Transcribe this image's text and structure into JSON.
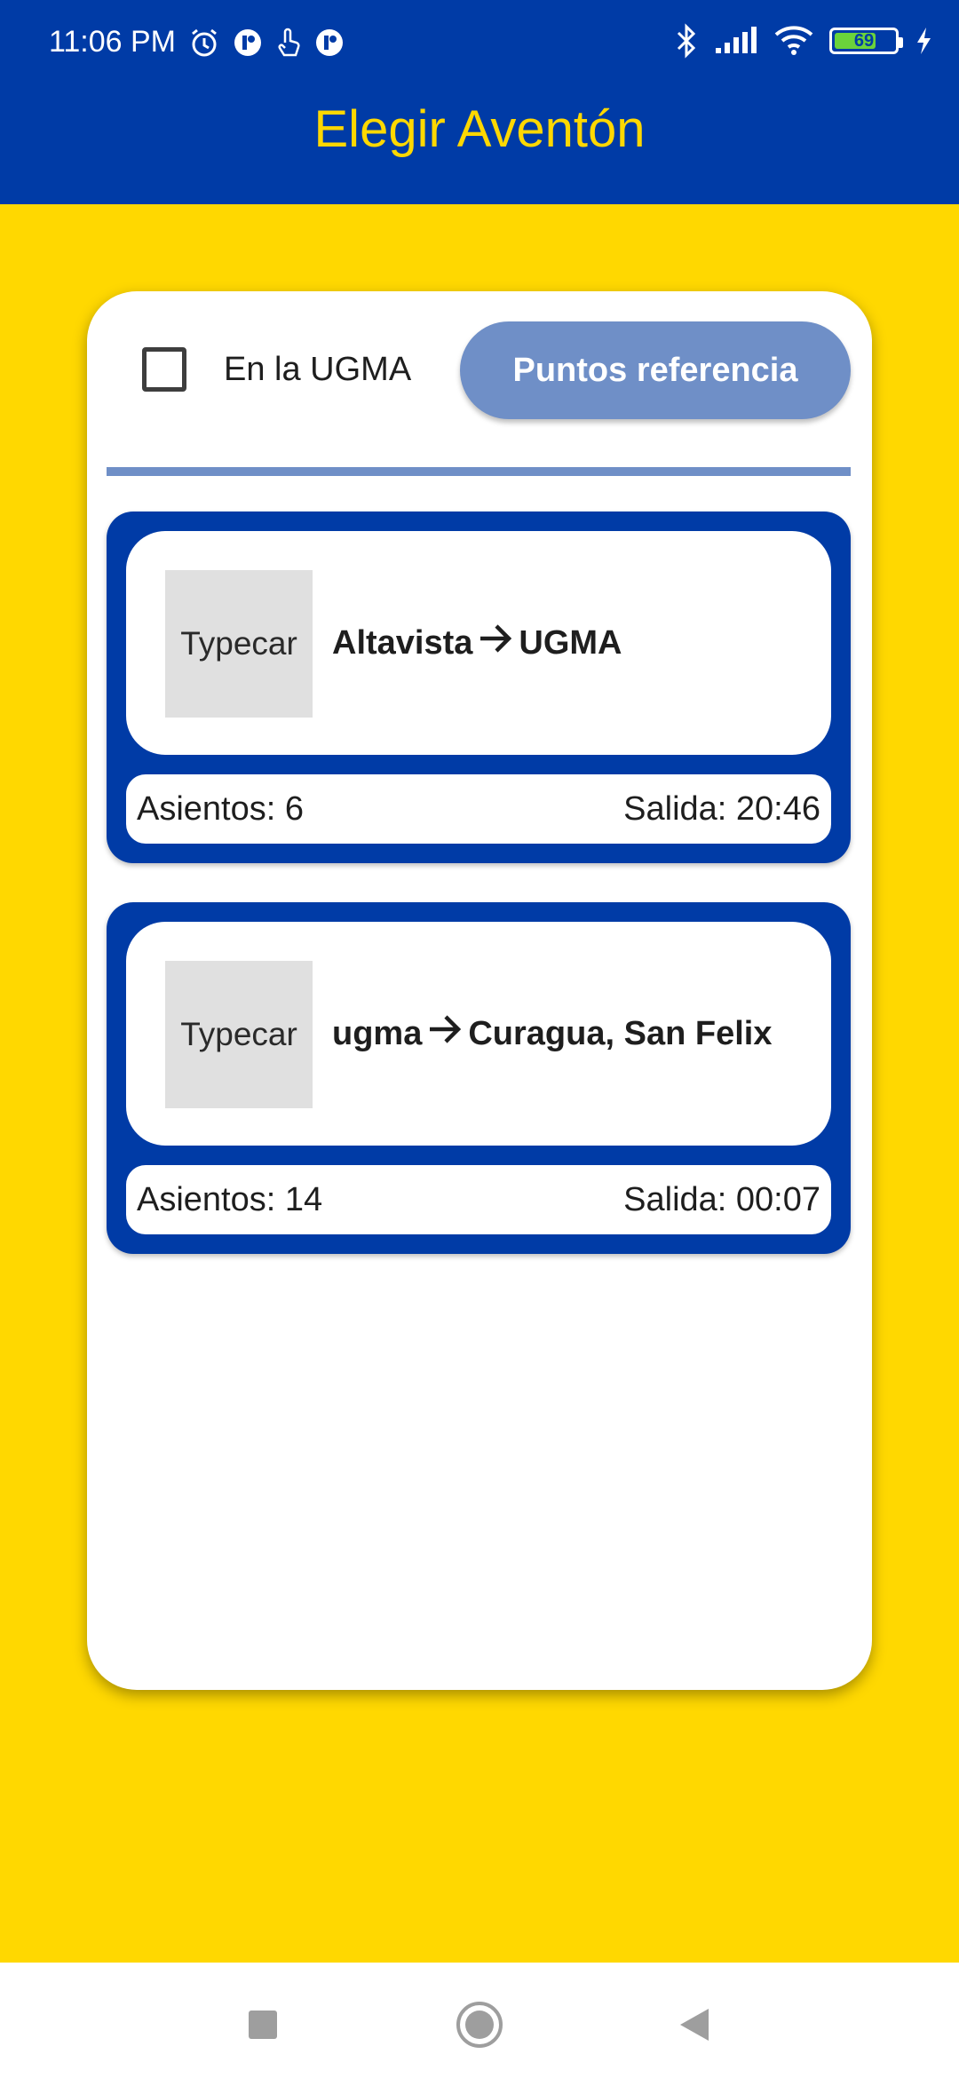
{
  "status_bar": {
    "time": "11:06 PM",
    "left_icons": [
      "alarm-icon",
      "notification-app-icon",
      "touch-icon",
      "notification-app-icon"
    ],
    "right_icons": [
      "bluetooth-icon",
      "cellular-signal-icon",
      "wifi-icon",
      "battery-icon",
      "charging-icon"
    ],
    "battery_level": "69",
    "battery_fraction": 0.69
  },
  "app_bar": {
    "title": "Elegir Aventón"
  },
  "filter": {
    "checkbox_label": "En la UGMA",
    "checkbox_checked": false,
    "reference_button_label": "Puntos referencia"
  },
  "rides": [
    {
      "thumbnail_label": "Typecar",
      "origin": "Altavista",
      "destination": "UGMA",
      "seats_text": "Asientos: 6",
      "departure_text": "Salida: 20:46"
    },
    {
      "thumbnail_label": "Typecar",
      "origin": "ugma",
      "destination": "Curagua, San Felix",
      "seats_text": "Asientos: 14",
      "departure_text": "Salida: 00:07"
    }
  ],
  "nav_bar": {
    "buttons": [
      "recent-apps-icon",
      "home-icon",
      "back-icon"
    ]
  },
  "colors": {
    "primary_blue": "#003BA6",
    "accent_yellow": "#FFD800",
    "button_blue": "#6F8FC7",
    "thumb_grey": "#E0E0E0"
  }
}
